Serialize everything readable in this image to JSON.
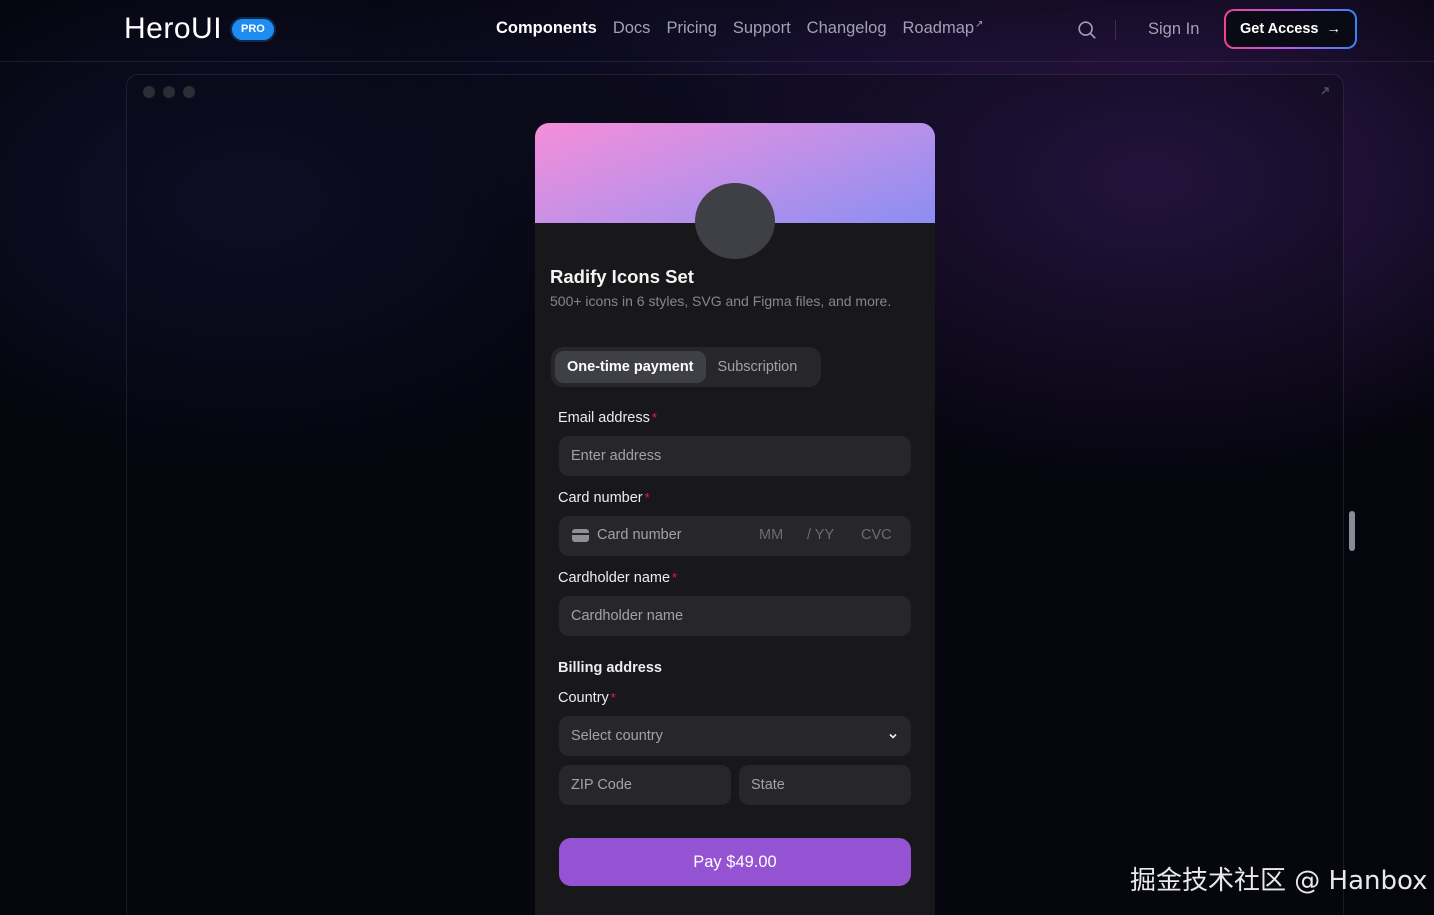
{
  "header": {
    "logo": "HeroUI",
    "badge": "PRO",
    "nav": [
      "Components",
      "Docs",
      "Pricing",
      "Support",
      "Changelog",
      "Roadmap"
    ],
    "active_nav": "Components",
    "external_link_mark": "↗",
    "sign_in": "Sign In",
    "get_access": "Get Access",
    "get_access_arrow": "→"
  },
  "product": {
    "title": "Radify Icons Set",
    "description": "500+ icons in 6 styles, SVG and Figma files, and more."
  },
  "tabs": [
    "One-time payment",
    "Subscription"
  ],
  "selected_tab": "One-time payment",
  "form": {
    "email_label": "Email address",
    "email_placeholder": "Enter address",
    "card_label": "Card number",
    "card_placeholder": "Card number",
    "mm": "MM",
    "yy": "/ YY",
    "cvc": "CVC",
    "cardholder_label": "Cardholder name",
    "cardholder_placeholder": "Cardholder name",
    "billing_heading": "Billing address",
    "country_label": "Country",
    "country_placeholder": "Select country",
    "zip_placeholder": "ZIP Code",
    "state_placeholder": "State",
    "required_mark": "*",
    "pay_label": "Pay $49.00"
  },
  "watermark": "掘金技术社区 @ Hanbox",
  "colors": {
    "accent": "#9353d3",
    "required": "#f31260",
    "pro_badge": "#1e8cf0"
  }
}
